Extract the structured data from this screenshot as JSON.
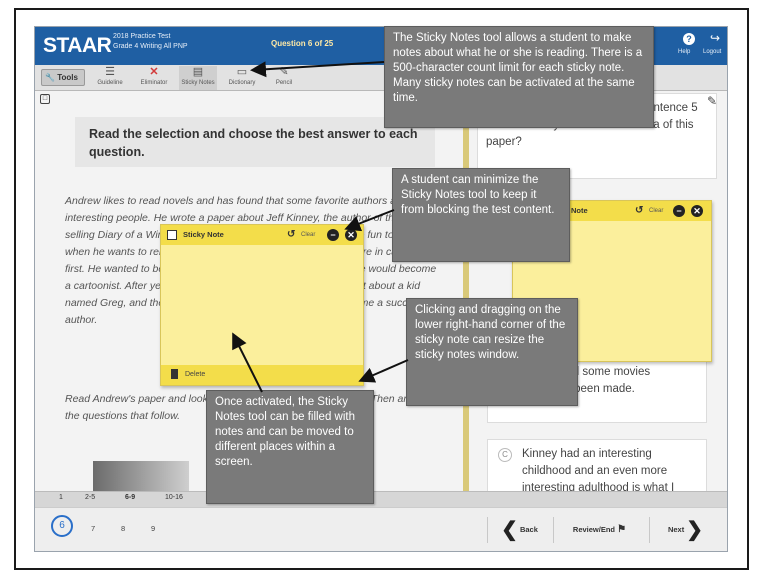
{
  "header": {
    "logo": "STAAR",
    "test_line1": "2018 Practice Test",
    "test_line2": "Grade 4 Writing All PNP",
    "question_counter": "Question 6 of 25",
    "help_label": "Help",
    "logout_label": "Logout"
  },
  "toolbar": {
    "tools_label": "Tools",
    "items": [
      {
        "label": "Guideline",
        "icon": "guideline-icon"
      },
      {
        "label": "Eliminator",
        "icon": "eliminator-icon"
      },
      {
        "label": "Sticky Notes",
        "icon": "sticky-notes-icon"
      },
      {
        "label": "Dictionary",
        "icon": "dictionary-icon"
      },
      {
        "label": "Pencil",
        "icon": "pencil-icon"
      }
    ]
  },
  "passage": {
    "instruction": "Read the selection and choose the best answer to each question.",
    "paragraph1": "Andrew likes to read novels and has found that some favorite authors are pretty interesting people. He wrote a paper about Jeff Kinney, the author of the best-selling Diary of a Wimpy Kid series. Andrew thinks the books are fun to read when he wants to relax. He found out that his favorite stories were in cartoons at first. He wanted to be known as an author; instead he thought he would become a cartoonist. After years of jokes and drawings, he made a report about a kid named Greg, and the series Diary of a Wimpy Kid, Kinney became a successful author.",
    "paragraph2": "Read Andrew's paper and look for revisions that he should make. Then answer the questions that follow."
  },
  "question": {
    "number": "6.",
    "text": "Which of these could follow sentence 5 and effectively state the main idea of this paper?",
    "answer_fragment_line1": "and some movies",
    "answer_fragment_line2": "have been made.",
    "answer_c_letter": "C",
    "answer_c_text": "Kinney had an interesting childhood and an even more interesting adulthood is what I think."
  },
  "sticky_main": {
    "title": "Sticky Note",
    "clear_label": "Clear",
    "delete_label": "Delete"
  },
  "sticky_right": {
    "title": "Note",
    "clear_label": "Clear"
  },
  "callouts": {
    "top": "The Sticky Notes tool allows a student to make notes about what he or she is reading. There is a 500-character count limit for each sticky note. Many sticky notes can be activated at the same time.",
    "minimize": "A student can minimize the Sticky Notes tool to keep it from blocking the test content.",
    "resize": "Clicking and dragging on the lower right-hand corner of the sticky note can resize the sticky notes window.",
    "activated": "Once activated, the Sticky Notes tool can be filled with notes and can be moved to different places within a screen."
  },
  "nav": {
    "tabs": [
      "1",
      "2-5",
      "6-9",
      "10-16",
      "17-25"
    ],
    "current_question": "6",
    "questions": [
      "7",
      "8",
      "9"
    ],
    "back_label": "Back",
    "review_label": "Review/End",
    "next_label": "Next"
  }
}
